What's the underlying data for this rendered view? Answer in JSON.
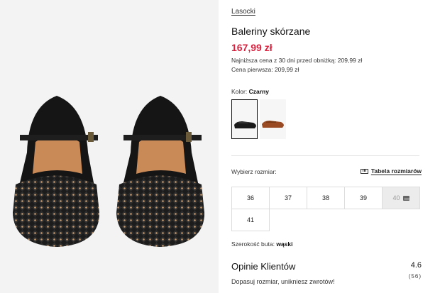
{
  "brand": "Lasocki",
  "product": {
    "title": "Baleriny skórzane",
    "price": "167,99 zł",
    "lowest_price_text": "Najniższa cena z 30 dni przed obniżką: 209,99 zł",
    "first_price_text": "Cena pierwsza: 209,99 zł"
  },
  "color": {
    "label": "Kolor:",
    "value": "Czarny",
    "swatches": [
      {
        "name": "black",
        "selected": true,
        "color": "#1a1a1a"
      },
      {
        "name": "brown",
        "selected": false,
        "color": "#9a4a22"
      }
    ]
  },
  "size": {
    "label": "Wybierz rozmiar:",
    "table_link": "Tabela rozmiarów",
    "options": [
      {
        "label": "36",
        "available": true
      },
      {
        "label": "37",
        "available": true
      },
      {
        "label": "38",
        "available": true
      },
      {
        "label": "39",
        "available": true
      },
      {
        "label": "40",
        "available": false
      },
      {
        "label": "41",
        "available": true
      }
    ]
  },
  "width": {
    "label": "Szerokość buta:",
    "value": "wąski"
  },
  "reviews": {
    "title": "Opinie Klientów",
    "rating": "4.6",
    "count": "(56)",
    "subtitle": "Dopasuj rozmiar, unikniesz zwrotów!"
  },
  "colors": {
    "price": "#d81f3c",
    "gallery_bg": "#f3f3f3"
  }
}
